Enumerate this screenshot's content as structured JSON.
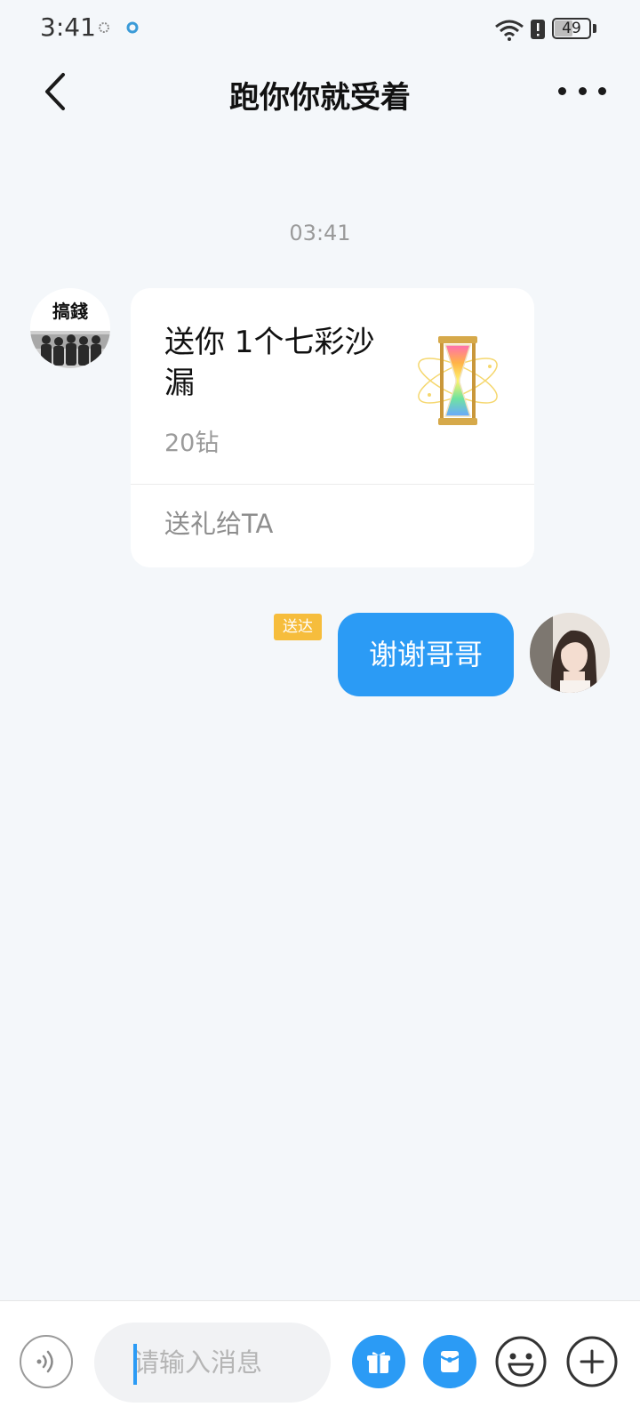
{
  "status_bar": {
    "time": "3:41",
    "battery_level": 49,
    "battery_text": "49",
    "icons": [
      "notification-icon",
      "app-notification-icon",
      "wifi-icon",
      "alert-icon",
      "battery-icon"
    ]
  },
  "header": {
    "title": "跑你你就受着",
    "back_icon": "chevron-left-icon",
    "more_icon": "more-horizontal-icon"
  },
  "chat": {
    "timestamp": "03:41",
    "incoming_gift": {
      "text": "送你 1个七彩沙漏",
      "price": "20钻",
      "action": "送礼给TA",
      "avatar_label": "搞錢",
      "gift_icon": "hourglass-icon"
    },
    "outgoing_message": {
      "text": "谢谢哥哥",
      "status": "送达"
    }
  },
  "input_bar": {
    "placeholder": "请输入消息",
    "value": "",
    "buttons": [
      "voice-icon",
      "gift-icon",
      "red-packet-icon",
      "emoji-icon",
      "plus-icon"
    ]
  },
  "colors": {
    "accent": "#2b9bf5",
    "badge": "#f6bd3c",
    "background": "#f4f7fa"
  }
}
